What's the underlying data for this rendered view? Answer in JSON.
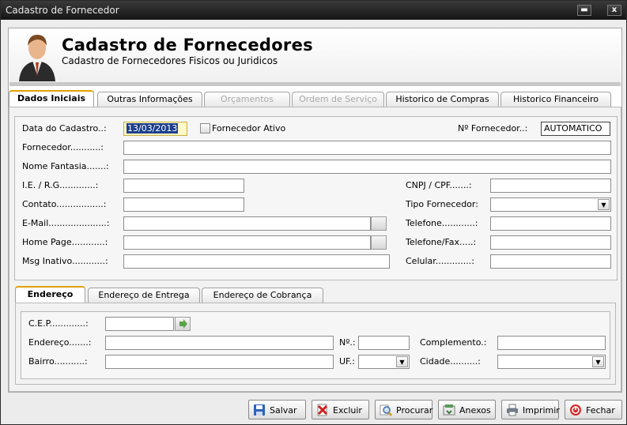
{
  "window": {
    "title": "Cadastro de Fornecedor",
    "minimize": "▬",
    "close": "x"
  },
  "header": {
    "title": "Cadastro de Fornecedores",
    "subtitle": "Cadastro de Fornecedores Fisicos ou Juridicos"
  },
  "tabs": [
    "Dados Iniciais",
    "Outras Informações",
    "Orçamentos",
    "Ordem de Serviço",
    "Historico de Compras",
    "Historico Financeiro"
  ],
  "form": {
    "data_cadastro_label": "Data do Cadastro..:",
    "data_cadastro_value": "13/03/2013",
    "ativo_label": "Fornecedor Ativo",
    "num_label": "Nº Fornecedor..:",
    "num_value": "AUTOMATICO",
    "fornecedor_label": "Fornecedor...........:",
    "nome_fantasia_label": "Nome Fantasia.......:",
    "ie_label": "I.E. / R.G.............:",
    "cnpj_label": "CNPJ / CPF.......:",
    "contato_label": "Contato.................:",
    "tipo_label": "Tipo Fornecedor:",
    "email_label": "E-Mail.....................:",
    "telefone_label": "Telefone............:",
    "homepage_label": "Home Page............:",
    "telfax_label": "Telefone/Fax.....:",
    "msg_label": "Msg Inativo............:",
    "celular_label": "Celular.............:"
  },
  "address_tabs": [
    "Endereço",
    "Endereço de Entrega",
    "Endereço de Cobrança"
  ],
  "address": {
    "cep_label": "C.E.P.............:",
    "endereco_label": "Endereço.......:",
    "numero_label": "Nº.:",
    "complemento_label": "Complemento.:",
    "bairro_label": "Bairro...........:",
    "uf_label": "UF.:",
    "cidade_label": "Cidade..........:"
  },
  "buttons": {
    "salvar": "Salvar",
    "excluir": "Excluir",
    "procurar": "Procurar",
    "anexos": "Anexos",
    "imprimir": "Imprimir",
    "fechar": "Fechar"
  },
  "colors": {
    "accent_tab": "#e0a000",
    "selection": "#1c3f8c"
  }
}
